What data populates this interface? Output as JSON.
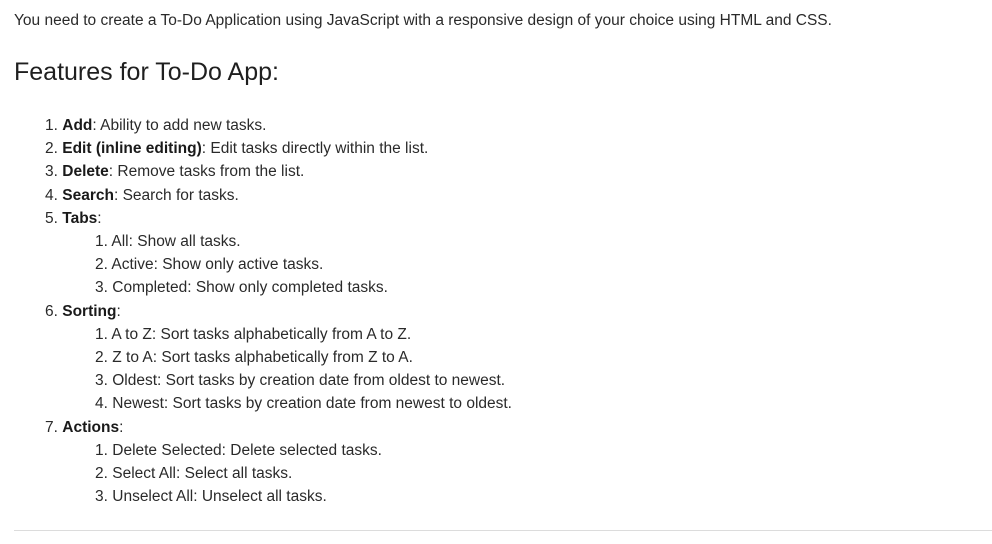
{
  "intro": "You need to create a To-Do Application using JavaScript with a responsive design of your choice using HTML and CSS.",
  "heading": "Features for To-Do App:",
  "features": [
    {
      "num": "1.",
      "term": "Add",
      "desc": ": Ability to add new tasks."
    },
    {
      "num": "2.",
      "term": "Edit (inline editing)",
      "desc": ": Edit tasks directly within the list."
    },
    {
      "num": "3.",
      "term": "Delete",
      "desc": ": Remove tasks from the list."
    },
    {
      "num": "4.",
      "term": "Search",
      "desc": ": Search for tasks."
    },
    {
      "num": "5.",
      "term": "Tabs",
      "desc": ":",
      "sub": [
        {
          "num": "1.",
          "text": "All: Show all tasks."
        },
        {
          "num": "2.",
          "text": "Active: Show only active tasks."
        },
        {
          "num": "3.",
          "text": "Completed: Show only completed tasks."
        }
      ]
    },
    {
      "num": "6.",
      "term": "Sorting",
      "desc": ":",
      "sub": [
        {
          "num": "1.",
          "text": "A to Z: Sort tasks alphabetically from A to Z."
        },
        {
          "num": "2.",
          "text": "Z to A: Sort tasks alphabetically from Z to A."
        },
        {
          "num": "3.",
          "text": "Oldest: Sort tasks by creation date from oldest to newest."
        },
        {
          "num": "4.",
          "text": "Newest: Sort tasks by creation date from newest to oldest."
        }
      ]
    },
    {
      "num": "7.",
      "term": "Actions",
      "desc": ":",
      "sub": [
        {
          "num": "1.",
          "text": "Delete Selected: Delete selected tasks."
        },
        {
          "num": "2.",
          "text": "Select All: Select all tasks."
        },
        {
          "num": "3.",
          "text": "Unselect All: Unselect all tasks."
        }
      ]
    }
  ]
}
